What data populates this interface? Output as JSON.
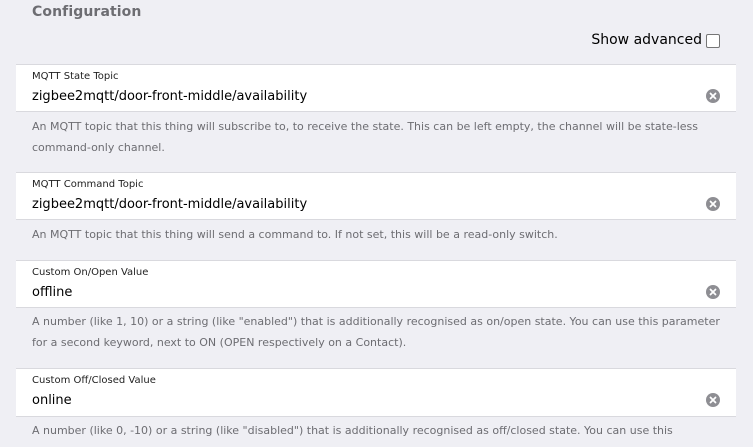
{
  "section": {
    "title": "Configuration"
  },
  "advanced": {
    "label": "Show advanced",
    "checked": false
  },
  "fields": [
    {
      "label": "MQTT State Topic",
      "value": "zigbee2mqtt/door-front-middle/availability",
      "description": "An MQTT topic that this thing will subscribe to, to receive the state. This can be left empty, the channel will be state-less command-only channel."
    },
    {
      "label": "MQTT Command Topic",
      "value": "zigbee2mqtt/door-front-middle/availability",
      "description": "An MQTT topic that this thing will send a command to. If not set, this will be a read-only switch."
    },
    {
      "label": "Custom On/Open Value",
      "value": "offline",
      "description": "A number (like 1, 10) or a string (like \"enabled\") that is additionally recognised as on/open state. You can use this parameter for a second keyword, next to ON (OPEN respectively on a Contact)."
    },
    {
      "label": "Custom Off/Closed Value",
      "value": "online",
      "description": "A number (like 0, -10) or a string (like \"disabled\") that is additionally recognised as off/closed state. You can use this parameter for a second keyword, next to OFF (CLOSED respectively on a Contact)."
    }
  ],
  "icons": {
    "clear": "clear-circle-icon"
  }
}
